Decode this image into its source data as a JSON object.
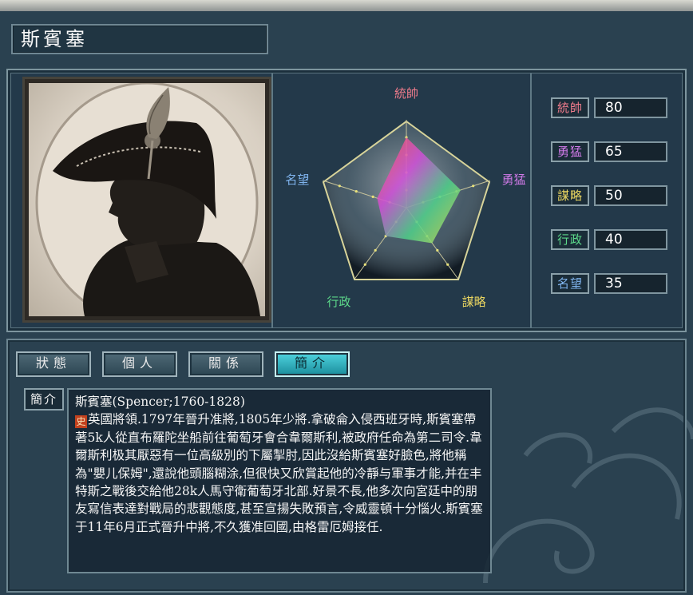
{
  "general": {
    "name": "斯賓塞"
  },
  "radar": {
    "labels": [
      {
        "text": "統帥",
        "color": "#f07c8c"
      },
      {
        "text": "勇猛",
        "color": "#d07ae8"
      },
      {
        "text": "謀略",
        "color": "#e8d460"
      },
      {
        "text": "行政",
        "color": "#5cd88a"
      },
      {
        "text": "名望",
        "color": "#7fb4ee"
      }
    ]
  },
  "stats": [
    {
      "label": "統帥",
      "value": "80",
      "color": "#f07c8c"
    },
    {
      "label": "勇猛",
      "value": "65",
      "color": "#d07ae8"
    },
    {
      "label": "謀略",
      "value": "50",
      "color": "#e8d460"
    },
    {
      "label": "行政",
      "value": "40",
      "color": "#5cd88a"
    },
    {
      "label": "名望",
      "value": "35",
      "color": "#7fb4ee"
    }
  ],
  "tabs": [
    {
      "label": "狀態",
      "active": false
    },
    {
      "label": "個人",
      "active": false
    },
    {
      "label": "關係",
      "active": false
    },
    {
      "label": "簡介",
      "active": true
    }
  ],
  "biography": {
    "label": "簡介",
    "title": "斯賓塞(Spencer;1760-1828)",
    "marker": "史",
    "text": "英國將領.1797年晉升准將,1805年少將.拿破侖入侵西班牙時,斯賓塞帶著5k人從直布羅陀坐船前往葡萄牙會合韋爾斯利,被政府任命為第二司令.韋爾斯利极其厭惡有一位高級別的下屬掣肘,因此沒給斯賓塞好臉色,將他稱為\"嬰儿保姆\",還說他頭腦糊涂,但很快又欣賞起他的冷靜与軍事才能,并在丰特斯之戰後交給他28k人馬守衛葡萄牙北部.好景不長,他多次向宮廷中的朋友寫信表達對戰局的悲觀態度,甚至宣揚失敗預言,令威靈頓十分惱火.斯賓塞于11年6月正式晉升中將,不久獲准回國,由格雷厄姆接任."
  },
  "colors": {
    "accent": "#3fc6d2",
    "frame": "#7d959e",
    "background": "#2a4150"
  }
}
